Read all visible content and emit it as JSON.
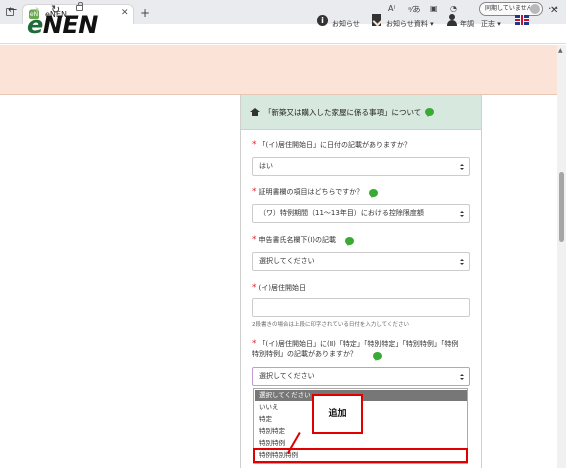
{
  "browser": {
    "tab_title": "eNEN",
    "tab_favicon": "eN",
    "sync_label": "同期していません",
    "icons": [
      "back-icon",
      "forward-icon",
      "refresh-icon",
      "lock-icon",
      "read-aloud-icon",
      "translate-icon",
      "extension-icon",
      "copilot-icon",
      "favorite-icon",
      "collections-icon",
      "more-icon"
    ]
  },
  "header": {
    "logo": "eNEN",
    "notice": "お知らせ",
    "notice_docs": "お知らせ資料 ▾",
    "user": "年調　正志 ▾"
  },
  "card": {
    "title": "「新築又は購入した家屋に係る事項」について"
  },
  "form": {
    "q1": {
      "label": "「(イ)居住開始日」に日付の記載がありますか？",
      "value": "はい"
    },
    "q2": {
      "label": "証明書欄の項目はどちらですか？",
      "value": "（ワ）特例期間（11～13年目）における控除限度額"
    },
    "q3": {
      "label": "申告書氏名欄下(Ⅰ)の記載",
      "value": "選択してください"
    },
    "q4": {
      "label": "(イ)居住開始日",
      "value": "",
      "hint": "2段書きの場合は上段に印字されている日付を入力してください"
    },
    "q5": {
      "label_line1": "「(イ)居住開始日」に(Ⅱ)「特定」「特別特定」「特別特例」「特例",
      "label_line2": "特別特例」の記載がありますか？",
      "value": "選択してください",
      "options": [
        "選択してください",
        "いいえ",
        "特定",
        "特別特定",
        "特別特例",
        "特例特別特例"
      ]
    }
  },
  "annotation": {
    "label": "追加"
  },
  "colors": {
    "header_bg": "#fbe4d7",
    "card_head_bg": "#d7e8df",
    "required": "#e2232a",
    "annotation": "#e00000"
  }
}
